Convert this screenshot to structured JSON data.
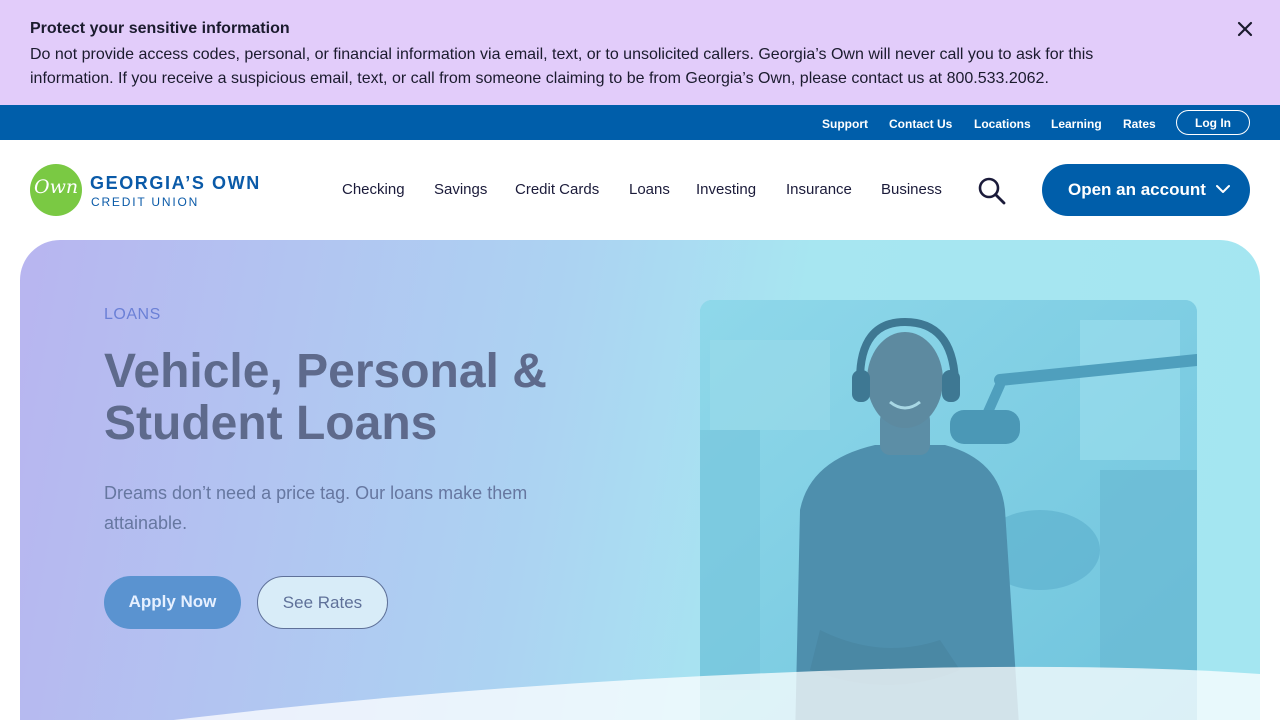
{
  "alert": {
    "title": "Protect your sensitive information",
    "body": "Do not provide access codes, personal, or financial information via email, text, or to unsolicited callers. Georgia’s Own will never call you to ask for this information. If you receive a suspicious email, text, or call from someone claiming to be from Georgia’s Own, please contact us at 800.533.2062.",
    "close_icon": "close-icon"
  },
  "utility_nav": {
    "links": [
      "Support",
      "Contact Us",
      "Locations",
      "Learning",
      "Rates"
    ],
    "login_label": "Log In"
  },
  "header": {
    "logo": {
      "mark": "Own",
      "name": "GEORGIA’S OWN",
      "sub": "CREDIT UNION"
    },
    "nav": [
      "Checking",
      "Savings",
      "Credit Cards",
      "Loans",
      "Investing",
      "Insurance",
      "Business"
    ],
    "search_icon": "search-icon",
    "cta_label": "Open an account",
    "cta_icon": "chevron-down-icon"
  },
  "hero": {
    "eyebrow": "LOANS",
    "title": "Vehicle, Personal & Student Loans",
    "subtitle": "Dreams don’t need a price tag. Our loans make them attainable.",
    "primary_button": "Apply Now",
    "secondary_button": "See Rates",
    "image_icon": "podcast-host-photo"
  },
  "colors": {
    "alert_bg": "#e2ccfa",
    "brand_blue": "#005eaa",
    "logo_green": "#7ac943",
    "hero_gradient_start": "#b8b5f0",
    "hero_gradient_end": "#a4e6f1"
  }
}
